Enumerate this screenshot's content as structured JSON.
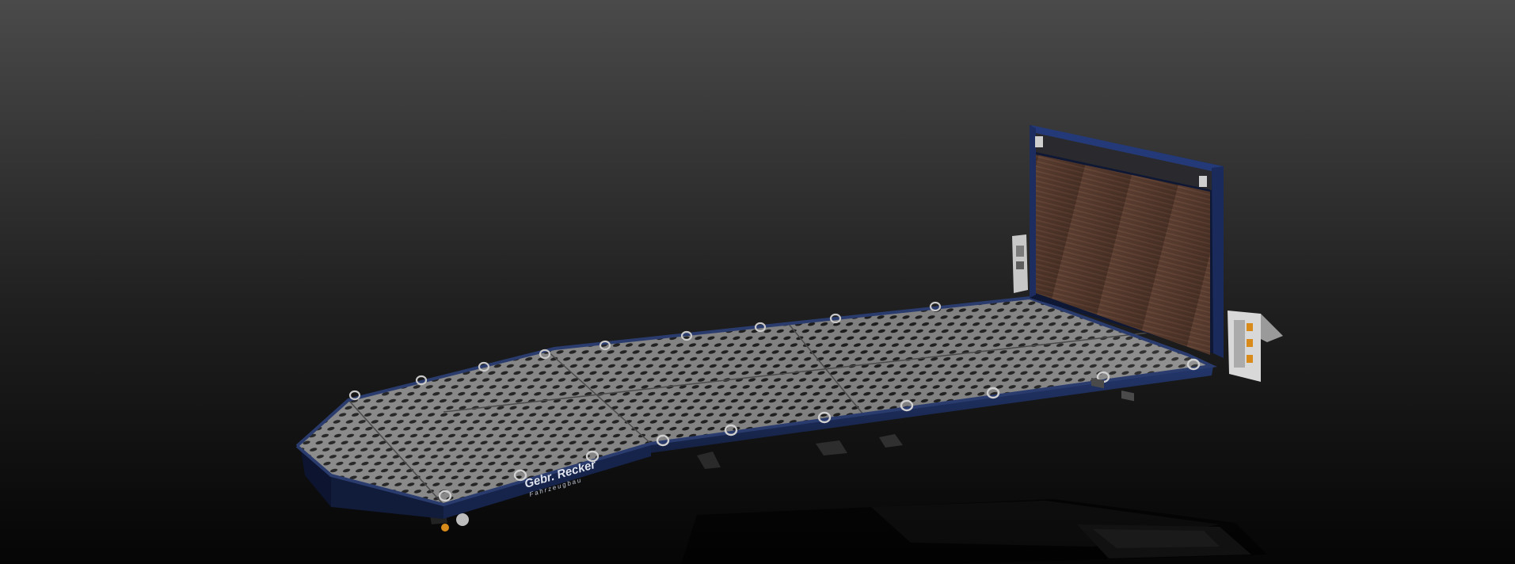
{
  "scene": {
    "subject": "flatbed-truck-body-render",
    "colors": {
      "background_top": "#4a4a4a",
      "background_bottom": "#050505",
      "frame_blue": "#1b2a55",
      "frame_blue_dark": "#0d1530",
      "deck_grey": "#8a8a8a",
      "deck_grey_dark": "#5f5f5f",
      "hole": "#1c1c1c",
      "wood": "#5a3d30",
      "wood_dark": "#3d2820",
      "steel": "#b5b5b5",
      "amber": "#d88a1a"
    }
  },
  "branding": {
    "name": "Gebr. Recker",
    "subtitle": "Fahrzeugbau"
  }
}
